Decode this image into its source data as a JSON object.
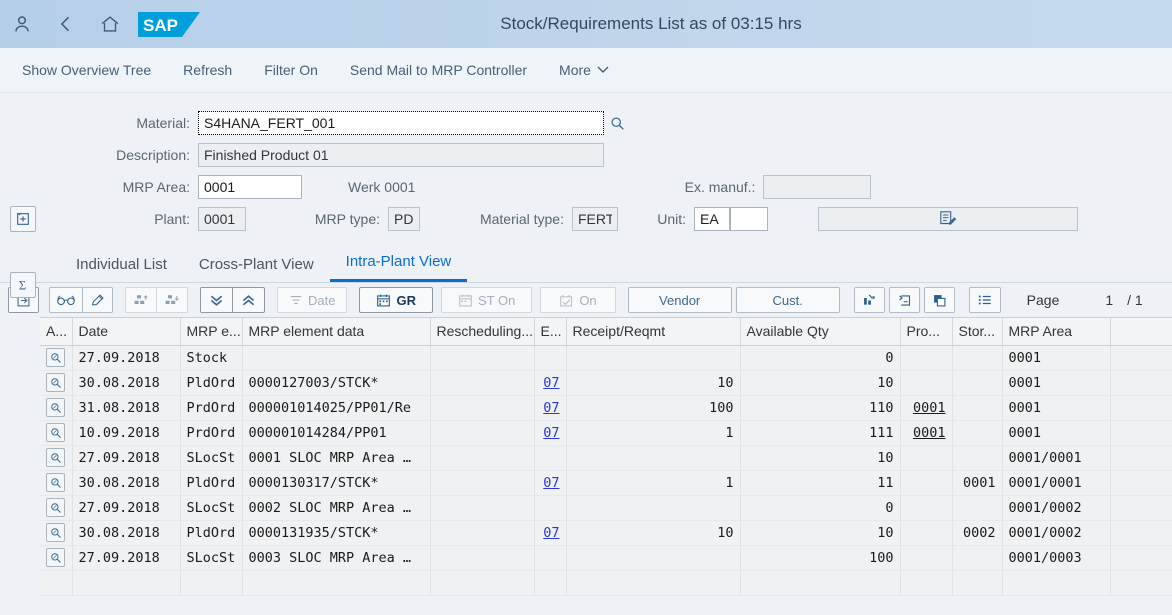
{
  "shell": {
    "title": "Stock/Requirements List as of 03:15 hrs",
    "logo": "SAP",
    "icons": [
      "user-icon",
      "back-icon",
      "home-icon"
    ]
  },
  "actionbar": {
    "items": [
      {
        "label": "Show Overview Tree"
      },
      {
        "label": "Refresh"
      },
      {
        "label": "Filter On"
      },
      {
        "label": "Send Mail to MRP Controller"
      },
      {
        "label": "More",
        "chevron": "⌄"
      }
    ]
  },
  "form": {
    "material_label": "Material:",
    "material_value": "S4HANA_FERT_001",
    "description_label": "Description:",
    "description_value": "Finished Product 01",
    "mrp_area_label": "MRP Area:",
    "mrp_area_value": "0001",
    "mrp_area_text": "Werk 0001",
    "ex_manuf_label": "Ex. manuf.:",
    "ex_manuf_value": "",
    "plant_label": "Plant:",
    "plant_value": "0001",
    "mrp_type_label": "MRP type:",
    "mrp_type_value": "PD",
    "material_type_label": "Material type:",
    "material_type_value": "FERT",
    "unit_label": "Unit:",
    "unit_value": "EA",
    "unit_value2": ""
  },
  "tabs": [
    {
      "label": "Individual List",
      "selected": false
    },
    {
      "label": "Cross-Plant View",
      "selected": false
    },
    {
      "label": "Intra-Plant View",
      "selected": true
    }
  ],
  "tabletoolbar": {
    "date_label": "Date",
    "gr_label": "GR",
    "st_on_label": "ST On",
    "on_label": "On",
    "vendor_label": "Vendor",
    "cust_label": "Cust.",
    "page_label": "Page",
    "page_current": "1",
    "page_total": "/ 1"
  },
  "table": {
    "columns": [
      "A...",
      "Date",
      "MRP e...",
      "MRP element data",
      "Rescheduling...",
      "E...",
      "Receipt/Reqmt",
      "Available Qty",
      "Pro...",
      "Stor...",
      "MRP Area",
      ""
    ],
    "rows": [
      {
        "date": "27.09.2018",
        "mrp_el": "Stock",
        "data": "",
        "resched": "",
        "e": "",
        "receipt": "",
        "avail": "0",
        "pro": "",
        "stor": "",
        "area": "0001",
        "blue": true
      },
      {
        "date": "30.08.2018",
        "mrp_el": "PldOrd",
        "data": "0000127003/STCK*",
        "resched": "",
        "e": "07",
        "receipt": "10",
        "avail": "10",
        "pro": "",
        "stor": "",
        "area": "0001",
        "blue": false
      },
      {
        "date": "31.08.2018",
        "mrp_el": "PrdOrd",
        "data": "000001014025/PP01/Re",
        "resched": "",
        "e": "07",
        "receipt": "100",
        "avail": "110",
        "pro": "0001",
        "stor": "",
        "area": "0001",
        "blue": false
      },
      {
        "date": "10.09.2018",
        "mrp_el": "PrdOrd",
        "data": "000001014284/PP01",
        "resched": "",
        "e": "07",
        "receipt": "1",
        "avail": "111",
        "pro": "0001",
        "stor": "",
        "area": "0001",
        "blue": false
      },
      {
        "date": "27.09.2018",
        "mrp_el": "SLocSt",
        "data": "0001 SLOC MRP Area …",
        "resched": "",
        "e": "",
        "receipt": "",
        "avail": "10",
        "pro": "",
        "stor": "",
        "area": "0001/0001",
        "blue": true
      },
      {
        "date": "30.08.2018",
        "mrp_el": "PldOrd",
        "data": "0000130317/STCK*",
        "resched": "",
        "e": "07",
        "receipt": "1",
        "avail": "11",
        "pro": "",
        "stor": "0001",
        "area": "0001/0001",
        "blue": false
      },
      {
        "date": "27.09.2018",
        "mrp_el": "SLocSt",
        "data": "0002 SLOC MRP Area …",
        "resched": "",
        "e": "",
        "receipt": "",
        "avail": "0",
        "pro": "",
        "stor": "",
        "area": "0001/0002",
        "blue": true
      },
      {
        "date": "30.08.2018",
        "mrp_el": "PldOrd",
        "data": "0000131935/STCK*",
        "resched": "",
        "e": "07",
        "receipt": "10",
        "avail": "10",
        "pro": "",
        "stor": "0002",
        "area": "0001/0002",
        "blue": false
      },
      {
        "date": "27.09.2018",
        "mrp_el": "SLocSt",
        "data": "0003 SLOC MRP Area …",
        "resched": "",
        "e": "",
        "receipt": "",
        "avail": "100",
        "pro": "",
        "stor": "",
        "area": "0001/0003",
        "blue": true
      }
    ]
  },
  "colors": {
    "accent": "#0a6ed1",
    "shell": "#bdd4ea",
    "link": "#2b36d8"
  }
}
